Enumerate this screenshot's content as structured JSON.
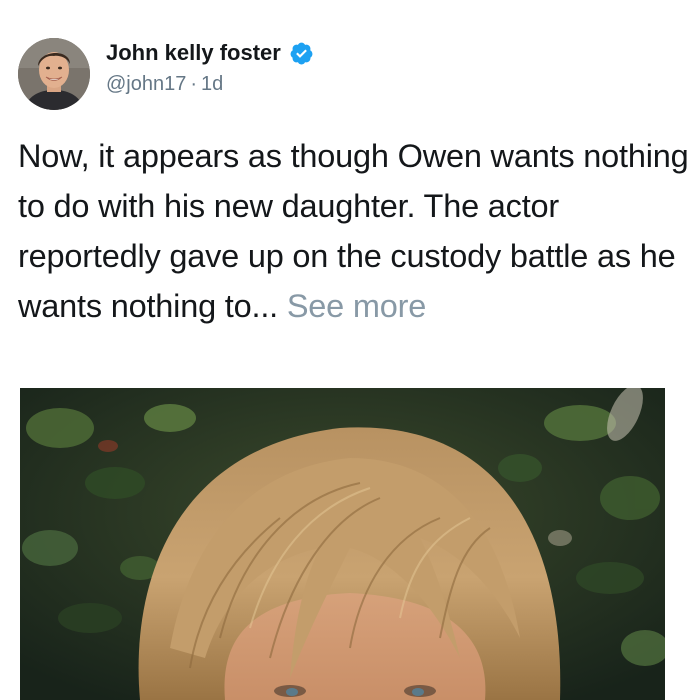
{
  "tweet": {
    "display_name": "John kelly foster",
    "verified": true,
    "handle": "@john17",
    "separator": "·",
    "age": "1d",
    "text": "Now, it appears as though Owen wants nothing to do with his new daughter. The actor reportedly gave up on the custody battle as he wants nothing to...",
    "see_more_label": "See more"
  },
  "colors": {
    "verified_blue": "#1da1f2",
    "secondary_text": "#657786",
    "see_more": "#8899a6",
    "primary_text": "#14171a"
  },
  "icons": {
    "verified": "verified-badge-icon",
    "avatar": "profile-photo",
    "media": "photo-man-blond-hair-foliage-background"
  }
}
